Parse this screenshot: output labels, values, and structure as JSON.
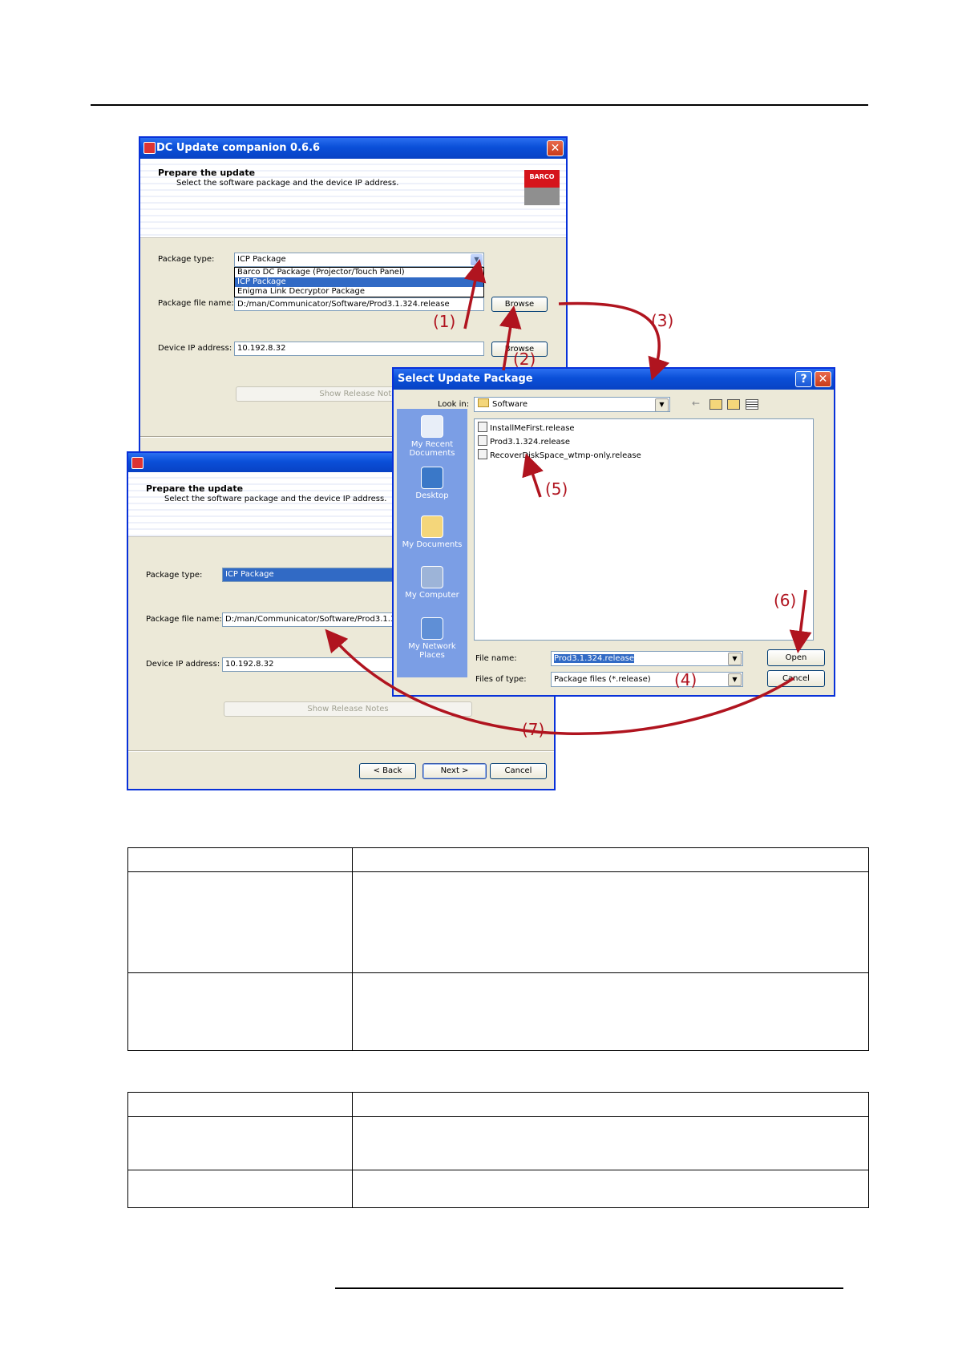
{
  "back_window": {
    "title": "DC Update companion 0.6.6",
    "header_title": "Prepare the update",
    "header_sub": "Select the software package and the device IP address.",
    "logo_text": "BARCO",
    "package_type_label": "Package type:",
    "package_type_value": "ICP Package",
    "dropdown_options": [
      "Barco DC Package (Projector/Touch Panel)",
      "ICP Package",
      "Enigma Link Decryptor Package"
    ],
    "dropdown_selected": "ICP Package",
    "package_file_label": "Package file name:",
    "package_file_value": "D:/man/Communicator/Software/Prod3.1.324.release",
    "browse_label": "Browse",
    "device_ip_label": "Device IP address:",
    "device_ip_value": "10.192.8.32",
    "browse2_label": "Browse",
    "release_notes_label": "Show Release Notes"
  },
  "front_window": {
    "header_title": "Prepare the update",
    "header_sub": "Select the software package and the device IP address.",
    "package_type_label": "Package type:",
    "package_type_value": "ICP Package",
    "package_file_label": "Package file name:",
    "package_file_value": "D:/man/Communicator/Software/Prod3.1.324.release",
    "device_ip_label": "Device IP address:",
    "device_ip_value": "10.192.8.32",
    "release_notes_label": "Show Release Notes",
    "back_label": "< Back",
    "next_label": "Next >",
    "cancel_label": "Cancel"
  },
  "select_dialog": {
    "title": "Select Update Package",
    "help_label": "?",
    "close_label": "X",
    "look_in_label": "Look in:",
    "look_in_value": "Software",
    "places": [
      "My Recent Documents",
      "Desktop",
      "My Documents",
      "My Computer",
      "My Network Places"
    ],
    "files": [
      "InstallMeFirst.release",
      "Prod3.1.324.release",
      "RecoverDiskSpace_wtmp-only.release"
    ],
    "file_name_label": "File name:",
    "file_name_value": "Prod3.1.324.release",
    "files_of_type_label": "Files of type:",
    "files_of_type_value": "Package files (*.release)",
    "open_label": "Open",
    "cancel_label": "Cancel"
  },
  "callouts": [
    "(1)",
    "(2)",
    "(3)",
    "(4)",
    "(5)",
    "(6)",
    "(7)"
  ],
  "colors": {
    "callout_red": "#b0141f",
    "xp_title_blue": "#0a4fd8",
    "dialog_face": "#ece9d8",
    "selection_blue": "#316ac5",
    "places_bar": "#7b9ee5"
  }
}
